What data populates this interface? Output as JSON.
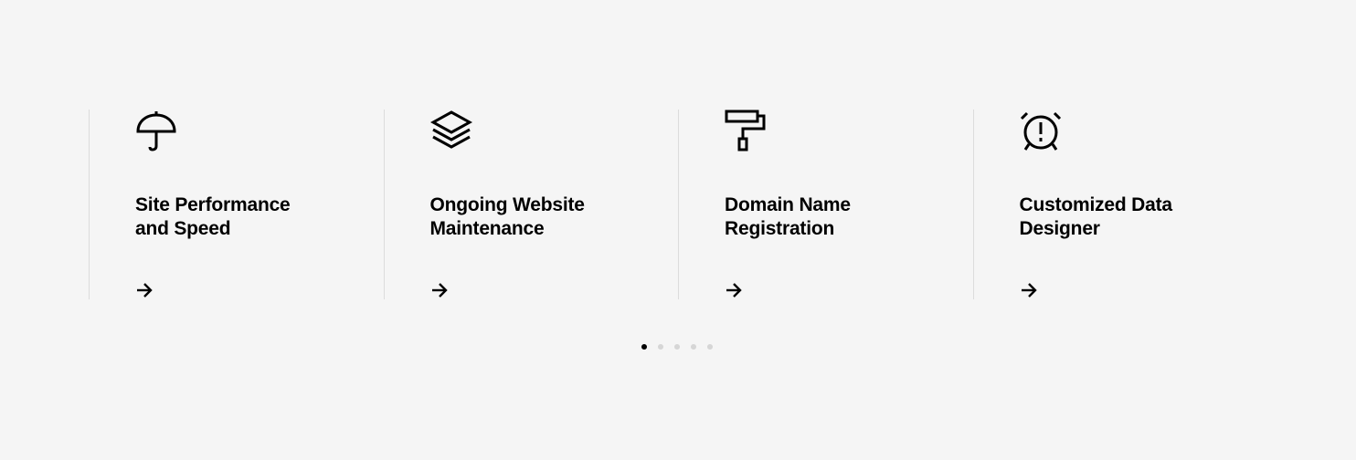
{
  "services": [
    {
      "icon": "umbrella-icon",
      "title_line1": "Site Performance",
      "title_line2": "and Speed"
    },
    {
      "icon": "layers-icon",
      "title_line1": "Ongoing Website",
      "title_line2": "Maintenance"
    },
    {
      "icon": "paint-roller-icon",
      "title_line1": "Domain Name",
      "title_line2": "Registration"
    },
    {
      "icon": "alarm-clock-icon",
      "title_line1": "Customized Data",
      "title_line2": "Designer"
    }
  ],
  "pagination": {
    "total": 5,
    "active_index": 0
  },
  "colors": {
    "background": "#f5f5f5",
    "text": "#000000",
    "divider": "#dcdcdc",
    "dot_inactive": "#d6d6d6",
    "dot_active": "#000000"
  }
}
